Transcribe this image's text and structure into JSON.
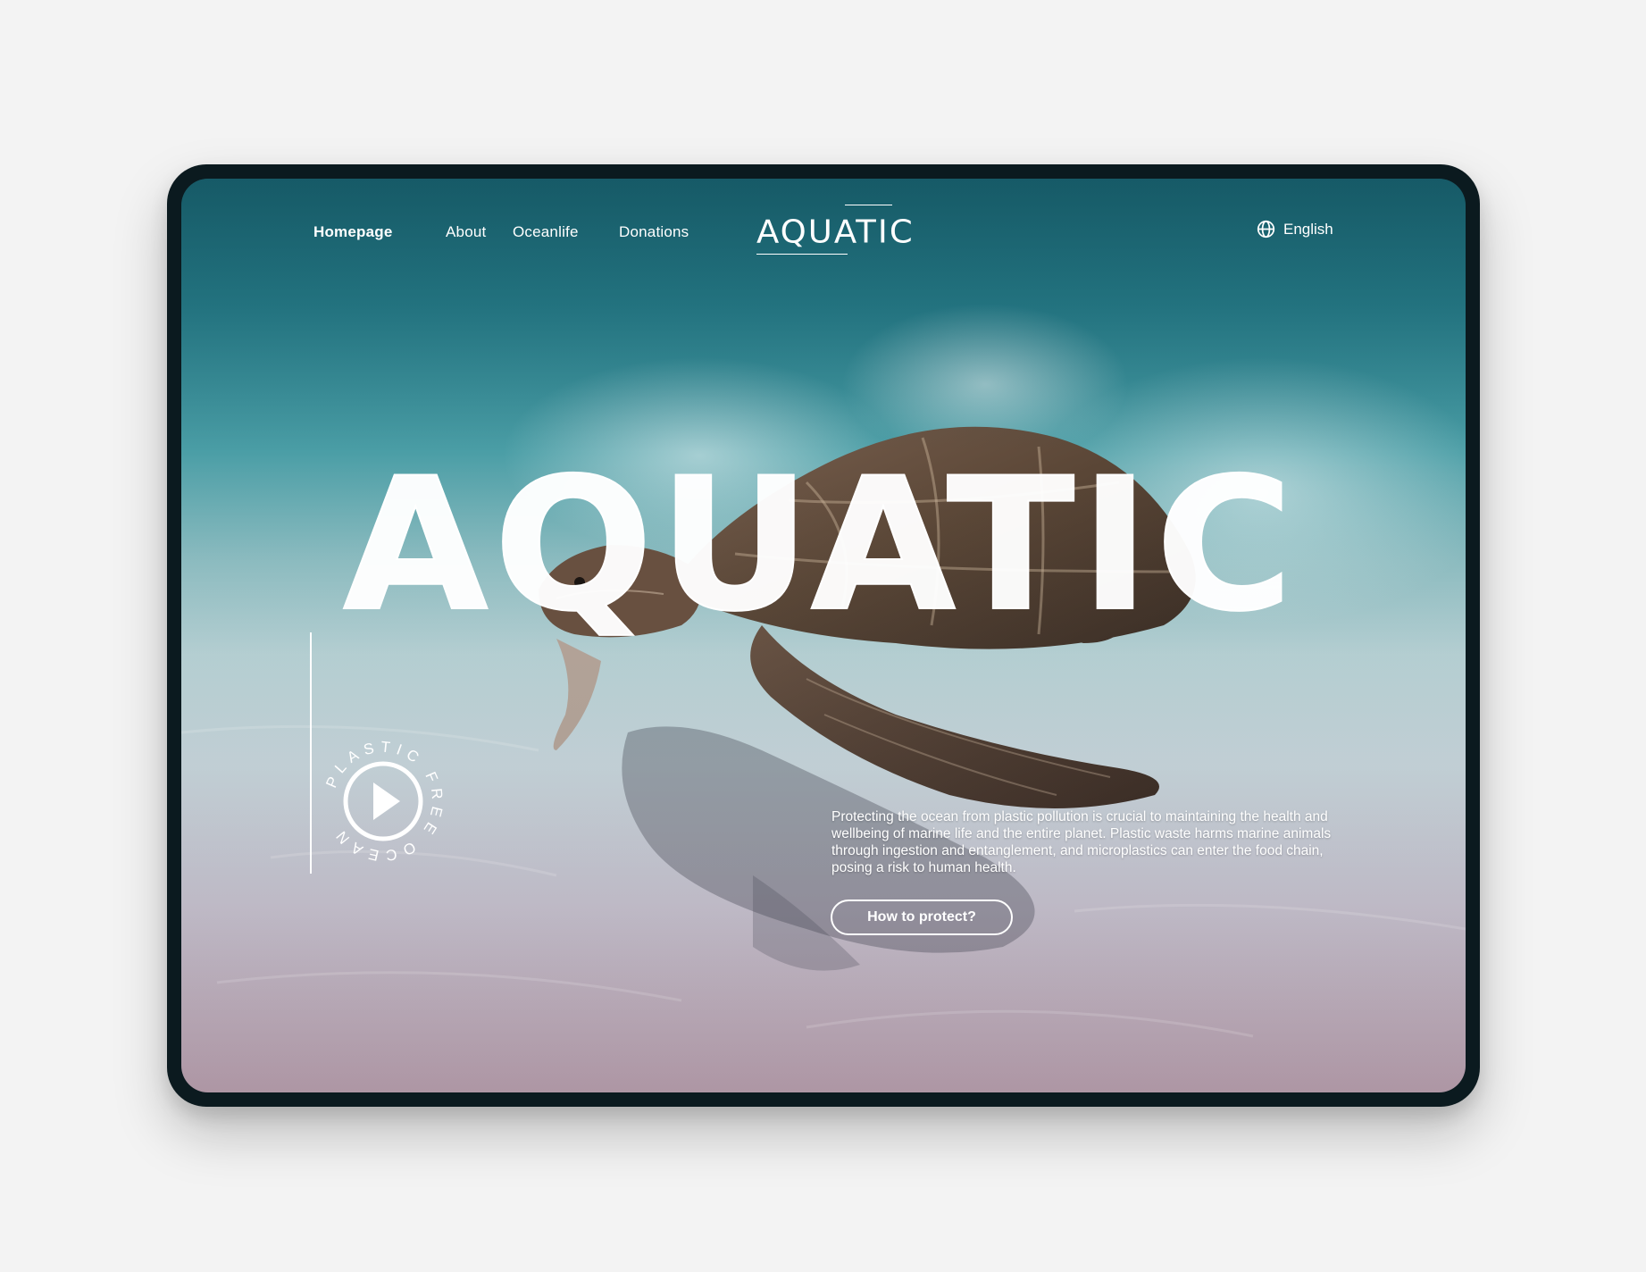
{
  "nav": {
    "items": [
      {
        "label": "Homepage",
        "active": true
      },
      {
        "label": "About"
      },
      {
        "label": "Oceanlife"
      },
      {
        "label": "Donations"
      }
    ],
    "logo": "AQUATIC",
    "language": "English",
    "language_icon": "globe-icon"
  },
  "hero": {
    "headline": "AQUATIC",
    "badge_text": "PLASTIC FREE OCEAN",
    "badge_icon": "play-icon",
    "description": "Protecting the ocean from plastic pollution is crucial to maintaining the health and wellbeing of marine life and the entire planet. Plastic waste harms marine animals through ingestion and entanglement, and microplastics can enter the food chain, posing a risk to human health.",
    "cta_label": "How to protect?"
  },
  "colors": {
    "water_top": "#1c6a78",
    "sand": "#c8c3cf",
    "text": "#ffffff",
    "frame": "#0b1a1f",
    "turtle_shell": "#5a4636"
  }
}
